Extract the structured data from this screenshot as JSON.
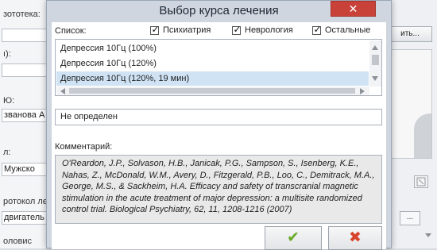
{
  "background": {
    "labels": [
      "зототека:",
      "ı):",
      "Ю:",
      "л:",
      "ротокол ле"
    ],
    "fields": [
      "званова А",
      "Мужско",
      "двигатель"
    ],
    "button_label": "ить...",
    "ellipsis_label": "...",
    "bottom_text": "оловис"
  },
  "dialog": {
    "title": "Выбор курса лечения",
    "list_label": "Список:",
    "filters": [
      {
        "label": "Психиатрия",
        "checked": true
      },
      {
        "label": "Неврология",
        "checked": true
      },
      {
        "label": "Остальные",
        "checked": true
      }
    ],
    "items": [
      {
        "label": "Депрессия 10Гц (100%)",
        "selected": false
      },
      {
        "label": "Депрессия 10Гц (120%)",
        "selected": false
      },
      {
        "label": "Депрессия 10Гц (120%, 19 мин)",
        "selected": true
      }
    ],
    "status_value": "Не определен",
    "comment_label": "Комментарий:",
    "comment_text": "O'Reardon, J.P., Solvason, H.B., Janicak, P.G., Sampson, S., Isenberg, K.E., Nahas, Z., McDonald, W.M., Avery, D., Fitzgerald, P.B., Loo, C., Demitrack, M.A., George, M.S., & Sackheim, H.A. Efficacy and safety of transcranial magnetic stimulation in the acute treatment of major depression: a multisite randomized control trial. Biological Psychiatry, 62, 11, 1208-1216 (2007)"
  },
  "icons": {
    "close": "close-icon",
    "ok": "checkmark-icon",
    "cancel": "cross-icon"
  },
  "colors": {
    "close_bg": "#c9423a",
    "selection": "#cfe3f5",
    "ok_glyph": "#6aaa2a",
    "cancel_glyph": "#d9442f"
  }
}
